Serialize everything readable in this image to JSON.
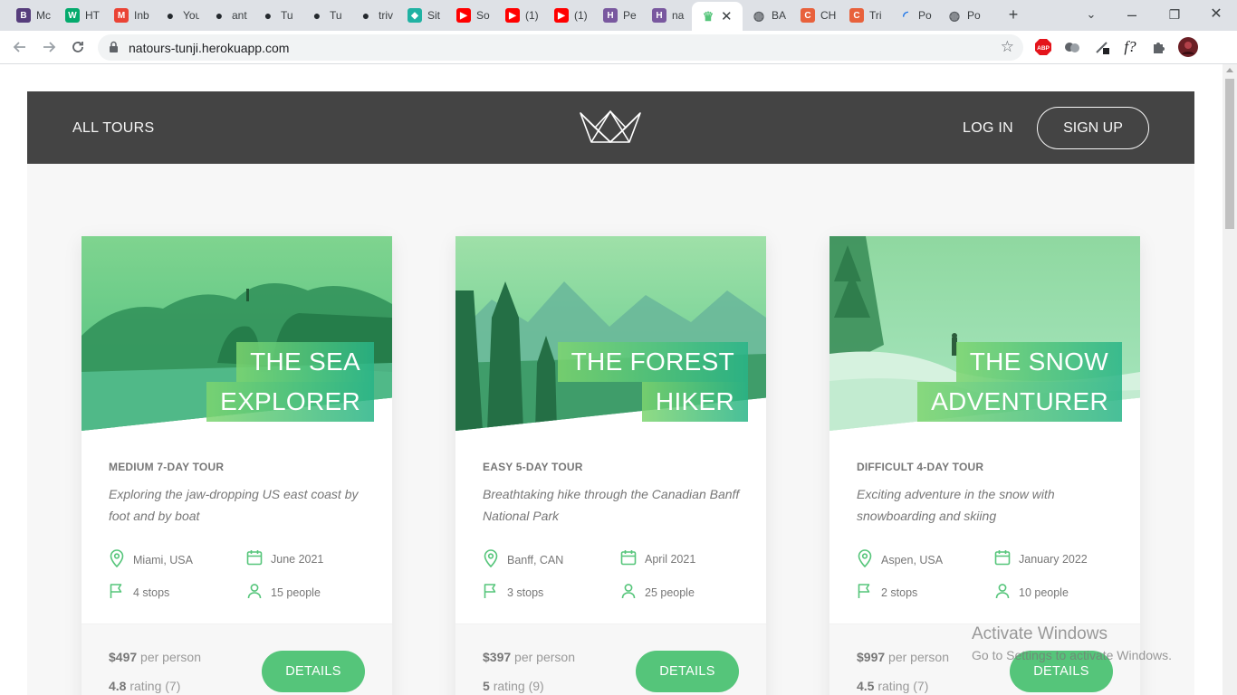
{
  "browser": {
    "tabs": [
      {
        "title": "Mc",
        "icon": "bootstrap-icon",
        "color": "#563d7c",
        "glyph": "B"
      },
      {
        "title": "HT",
        "icon": "w3schools-icon",
        "color": "#04aa6d",
        "glyph": "W"
      },
      {
        "title": "Inb",
        "icon": "gmail-icon",
        "color": "#ea4335",
        "glyph": "M"
      },
      {
        "title": "You",
        "icon": "github-icon",
        "color": "#24292e",
        "glyph": "●"
      },
      {
        "title": "ant",
        "icon": "github-icon",
        "color": "#24292e",
        "glyph": "●"
      },
      {
        "title": "Tu",
        "icon": "github-icon",
        "color": "#24292e",
        "glyph": "●"
      },
      {
        "title": "Tu",
        "icon": "github-icon",
        "color": "#24292e",
        "glyph": "●"
      },
      {
        "title": "triv",
        "icon": "github-icon",
        "color": "#24292e",
        "glyph": "●"
      },
      {
        "title": "Sit",
        "icon": "netlify-icon",
        "color": "#20b2a3",
        "glyph": "◆"
      },
      {
        "title": "So",
        "icon": "youtube-icon",
        "color": "#ff0000",
        "glyph": "▶"
      },
      {
        "title": "(1)",
        "icon": "youtube-icon",
        "color": "#ff0000",
        "glyph": "▶"
      },
      {
        "title": "(1)",
        "icon": "youtube-icon",
        "color": "#ff0000",
        "glyph": "▶"
      },
      {
        "title": "Pe",
        "icon": "heroku-icon",
        "color": "#79589f",
        "glyph": "H"
      },
      {
        "title": "na",
        "icon": "heroku-icon",
        "color": "#79589f",
        "glyph": "H"
      },
      {
        "title": "",
        "icon": "natours-icon",
        "color": "#55c57a",
        "glyph": "♛",
        "active": true
      },
      {
        "title": "BA",
        "icon": "globe-icon",
        "color": "#5f6368",
        "glyph": "◍"
      },
      {
        "title": "CH",
        "icon": "codepen-icon",
        "color": "#e8613c",
        "glyph": "C"
      },
      {
        "title": "Tri",
        "icon": "codepen-icon",
        "color": "#e8613c",
        "glyph": "C"
      },
      {
        "title": "Po",
        "icon": "loading-icon",
        "color": "#1a73e8",
        "glyph": "◜"
      },
      {
        "title": "Po",
        "icon": "globe-icon",
        "color": "#5f6368",
        "glyph": "◍"
      }
    ],
    "url": "natours-tunji.herokuapp.com",
    "extensions": [
      "adblock-icon",
      "extension-icon",
      "devtools-icon",
      "formula-icon",
      "puzzle-icon",
      "profile-avatar"
    ],
    "abp_label": "ABP",
    "formula_label": "f?"
  },
  "site": {
    "nav": {
      "all_tours": "ALL TOURS",
      "login": "LOG IN",
      "signup": "SIGN UP"
    },
    "tours": [
      {
        "title_l1": "THE SEA",
        "title_l2": "EXPLORER",
        "subheading": "MEDIUM 7-DAY TOUR",
        "summary": "Exploring the jaw-dropping US east coast by foot and by boat",
        "location": "Miami, USA",
        "date": "June 2021",
        "stops": "4 stops",
        "people": "15 people",
        "price": "$497",
        "price_unit": "per person",
        "rating": "4.8",
        "rating_label": "rating (7)",
        "button": "DETAILS"
      },
      {
        "title_l1": "THE FOREST",
        "title_l2": "HIKER",
        "subheading": "EASY 5-DAY TOUR",
        "summary": "Breathtaking hike through the Canadian Banff National Park",
        "location": "Banff, CAN",
        "date": "April 2021",
        "stops": "3 stops",
        "people": "25 people",
        "price": "$397",
        "price_unit": "per person",
        "rating": "5",
        "rating_label": "rating (9)",
        "button": "DETAILS"
      },
      {
        "title_l1": "THE SNOW",
        "title_l2": "ADVENTURER",
        "subheading": "DIFFICULT 4-DAY TOUR",
        "summary": "Exciting adventure in the snow with snowboarding and skiing",
        "location": "Aspen, USA",
        "date": "January 2022",
        "stops": "2 stops",
        "people": "10 people",
        "price": "$997",
        "price_unit": "per person",
        "rating": "4.5",
        "rating_label": "rating (7)",
        "button": "DETAILS"
      }
    ]
  },
  "watermark": {
    "line1": "Activate Windows",
    "line2": "Go to Settings to activate Windows."
  },
  "colors": {
    "brand_green": "#55c57a",
    "header_bg": "#444444",
    "page_bg": "#f7f7f7"
  }
}
